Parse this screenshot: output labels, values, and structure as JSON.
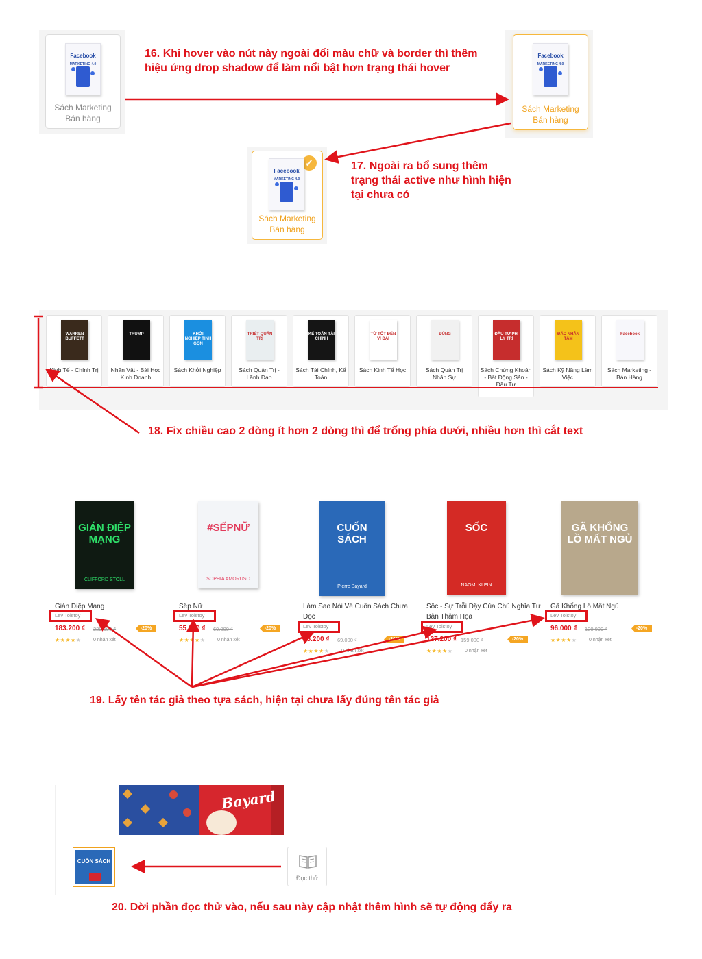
{
  "category_states": {
    "label_line1": "Sách Marketing",
    "label_line2": "Bán hàng",
    "book_title": "Facebook",
    "book_subtitle": "MARKETING 4.0",
    "check_icon": "check-icon"
  },
  "notes": {
    "n16": "16. Khi hover vào nút này ngoài đổi màu chữ và border  thì thêm hiệu ứng drop shadow để làm nổi bật hơn trạng thái hover",
    "n17": "17. Ngoài ra bổ sung thêm trạng thái active như hình hiện tại chưa có",
    "n18": "18. Fix chiều cao 2 dòng ít hơn 2 dòng thì để trống phía dưới, nhiều hơn thì cắt text",
    "n19": "19. Lấy tên tác giả theo tựa sách, hiện tại chưa lấy đúng tên tác giả",
    "n20": "20. Dời phần đọc thử vào, nếu sau này cập nhật thêm hình sẽ tự động đẩy ra"
  },
  "categories": [
    {
      "name": "Kinh Tế - Chính Trị",
      "cover_text": "WARREN BUFFETT",
      "color": "#3a2a1c"
    },
    {
      "name": "Nhân Vật - Bài Học Kinh Doanh",
      "cover_text": "TRUMP",
      "color": "#111111"
    },
    {
      "name": "Sách Khởi Nghiệp",
      "cover_text": "KHỞI NGHIỆP TINH GỌN",
      "color": "#1b8fe0"
    },
    {
      "name": "Sách Quản Trị - Lãnh Đạo",
      "cover_text": "TRIẾT QUẢN TRỊ",
      "color": "#e9eef0"
    },
    {
      "name": "Sách Tài Chính, Kế Toán",
      "cover_text": "KẾ TOÁN TÀI CHÍNH",
      "color": "#151515"
    },
    {
      "name": "Sách Kinh Tế Học",
      "cover_text": "TỪ TỐT ĐẾN VĨ ĐẠI",
      "color": "#ffffff"
    },
    {
      "name": "Sách Quản Trị Nhân Sự",
      "cover_text": "ĐÚNG",
      "color": "#f1f1f1"
    },
    {
      "name": "Sách Chứng Khoán - Bất Động Sản - Đầu Tư",
      "cover_text": "ĐẦU TƯ PHI LÝ TRÍ",
      "color": "#c62d2d"
    },
    {
      "name": "Sách Kỹ Năng Làm Việc",
      "cover_text": "ĐẮC NHÂN TÂM",
      "color": "#f4c21a"
    },
    {
      "name": "Sách Marketing - Bán Hàng",
      "cover_text": "Facebook",
      "color": "#f7f7fb"
    }
  ],
  "products": [
    {
      "title": "Gián Điệp Mạng",
      "author": "Lev Tolstoy",
      "price": "183.200 ₫",
      "old_price": "229.000 ₫",
      "discount": "-20%",
      "reviews": "0 nhận xét",
      "cover_text": "GIÁN ĐIỆP MẠNG",
      "cover_sub": "CLIFFORD STOLL",
      "color": "#0f1a12",
      "text_color": "#2fe06a"
    },
    {
      "title": "Sếp Nữ",
      "author": "Lev Tolstoy",
      "price": "55.200 ₫",
      "old_price": "69.000 ₫",
      "discount": "-20%",
      "reviews": "0 nhận xét",
      "cover_text": "#SẾPNỮ",
      "cover_sub": "SOPHIA AMORUSO",
      "color": "#f3f5f8",
      "text_color": "#e23a5a"
    },
    {
      "title": "Làm Sao Nói Về Cuốn Sách Chưa Đọc",
      "author": "Lev Tolstoy",
      "price": "55.200 ₫",
      "old_price": "69.000 ₫",
      "discount": "-20%",
      "reviews": "0 nhận xét",
      "cover_text": "CUỐN SÁCH",
      "cover_sub": "Pierre Bayard",
      "color": "#2a69b8",
      "text_color": "#ffffff"
    },
    {
      "title": "Sốc - Sự Trỗi Dậy Của Chủ Nghĩa Tư Bản Thảm Họa",
      "author": "Lev Tolstoy",
      "price": "127.200 ₫",
      "old_price": "159.000 ₫",
      "discount": "-20%",
      "reviews": "0 nhận xét",
      "cover_text": "SỐC",
      "cover_sub": "NAOMI KLEIN",
      "color": "#d42a25",
      "text_color": "#ffffff"
    },
    {
      "title": "Gã Khổng Lồ Mất Ngủ",
      "author": "Lev Tolstoy",
      "price": "96.000 ₫",
      "old_price": "120.000 ₫",
      "discount": "-20%",
      "reviews": "0 nhận xét",
      "cover_text": "GÃ KHỔNG LỒ MẤT NGỦ",
      "cover_sub": "",
      "color": "#b8a88c",
      "text_color": "#ffffff"
    }
  ],
  "doc_thu": {
    "label": "Đọc thử",
    "icon": "book-open-icon",
    "banner_text": "Bayard",
    "thumb_text": "CUỐN SÁCH"
  },
  "colors": {
    "annotation_red": "#e0141b",
    "accent_orange": "#f6b73c",
    "price_red": "#e0141b"
  }
}
